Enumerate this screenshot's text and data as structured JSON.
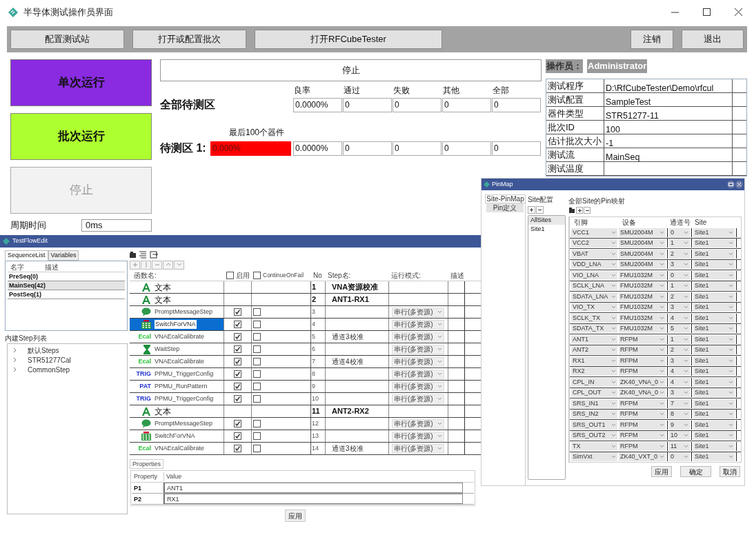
{
  "window": {
    "title": "半导体测试操作员界面"
  },
  "toolbar_left": [
    {
      "label": "配置测试站"
    },
    {
      "label": "打开或配置批次"
    },
    {
      "label": "打开RFCubeTester"
    }
  ],
  "toolbar_right": [
    {
      "label": "注销"
    },
    {
      "label": "退出"
    }
  ],
  "run_buttons": [
    {
      "label": "单次运行",
      "kind": "single",
      "disabled": false
    },
    {
      "label": "批次运行",
      "kind": "batch",
      "disabled": false
    },
    {
      "label": "停止",
      "kind": "stop",
      "disabled": true
    }
  ],
  "cycle_time": {
    "label": "周期时间",
    "value": "0ms"
  },
  "status": "停止",
  "stats": {
    "columns": [
      "良率",
      "通过",
      "失败",
      "其他",
      "全部"
    ],
    "all": {
      "label": "全部待测区",
      "values": [
        "0.0000%",
        "0",
        "0",
        "0",
        "0"
      ]
    },
    "sites": [
      {
        "label": "待测区 1:",
        "caption": "最后100个器件",
        "bar": "0.000%",
        "values": [
          "0.0000%",
          "0",
          "0",
          "0",
          "0"
        ]
      }
    ]
  },
  "operator": {
    "label": "操作员：",
    "name": "Administrator"
  },
  "info": [
    {
      "key": "测试程序",
      "value": "D:\\RfCubeTester\\Demo\\rfcul"
    },
    {
      "key": "测试配置",
      "value": "SampleTest"
    },
    {
      "key": "器件类型",
      "value": "STR51277-11"
    },
    {
      "key": "批次ID",
      "value": "100"
    },
    {
      "key": "估计批次大小",
      "value": "-1"
    },
    {
      "key": "测试流",
      "value": "MainSeq"
    },
    {
      "key": "测试温度"
    }
  ],
  "flow_editor": {
    "title": "TestFlowEdit",
    "tabs": [
      {
        "label": "SequenceList",
        "selected": true
      },
      {
        "label": "Variables",
        "selected": false
      }
    ],
    "sequence_columns": [
      "名字",
      "描述"
    ],
    "sequences": [
      {
        "name": "PreSeq(0)",
        "selected": false
      },
      {
        "name": "MainSeq(42)",
        "selected": true
      },
      {
        "name": "PostSeq(1)",
        "selected": false
      }
    ],
    "builtin_title": "内建Step列表",
    "builtin": [
      {
        "label": "默认Steps",
        "expanded": false
      },
      {
        "label": "STR51277Cal",
        "expanded": false
      },
      {
        "label": "CommonStep",
        "expanded": false
      }
    ],
    "columns": {
      "func": "函数名:",
      "enabled": "启用",
      "continue": "ContinueOnFail",
      "no": "No",
      "step": "Step名:",
      "mode": "运行模式:",
      "desc": "描述"
    },
    "header_checks": {
      "enabled": false,
      "continue": false
    },
    "steps": [
      {
        "kind": "text",
        "name": "文本",
        "no": "1",
        "step": "VNA资源校准",
        "selected": false
      },
      {
        "kind": "text",
        "name": "文本",
        "no": "2",
        "step": "ANT1-RX1",
        "selected": false
      },
      {
        "kind": "prompt",
        "name": "PromptMessageStep",
        "enabled": true,
        "continue_on_fail": false,
        "no": "3",
        "mode": "串行(多资源)",
        "selected": false
      },
      {
        "kind": "switch",
        "name": "SwitchForVNA",
        "enabled": true,
        "continue_on_fail": false,
        "no": "4",
        "mode": "串行(多资源)",
        "selected": true
      },
      {
        "kind": "tag",
        "tag": "Ecal",
        "name": "VNAEcalCalibrate",
        "enabled": true,
        "continue_on_fail": false,
        "no": "5",
        "step": "通道3校准",
        "mode": "串行(多资源)",
        "selected": false
      },
      {
        "kind": "wait",
        "name": "WaitStep",
        "enabled": true,
        "continue_on_fail": false,
        "no": "6",
        "mode": "串行(多资源)",
        "selected": false
      },
      {
        "kind": "tag",
        "tag": "Ecal",
        "name": "VNAEcalCalibrate",
        "enabled": true,
        "continue_on_fail": false,
        "no": "7",
        "step": "通道4校准",
        "mode": "串行(多资源)",
        "selected": false
      },
      {
        "kind": "tag",
        "tag": "TRIG",
        "name": "PPMU_TriggerConfig",
        "enabled": true,
        "continue_on_fail": false,
        "no": "8",
        "mode": "串行(多资源)",
        "selected": false
      },
      {
        "kind": "tag",
        "tag": "PAT",
        "name": "PPMU_RunPattern",
        "enabled": true,
        "continue_on_fail": false,
        "no": "9",
        "mode": "串行(多资源)",
        "selected": false
      },
      {
        "kind": "tag",
        "tag": "TRIG",
        "name": "PPMU_TriggerConfig",
        "enabled": true,
        "continue_on_fail": false,
        "no": "10",
        "mode": "串行(多资源)",
        "selected": false
      },
      {
        "kind": "text",
        "name": "文本",
        "no": "11",
        "step": "ANT2-RX2",
        "selected": false
      },
      {
        "kind": "prompt",
        "name": "PromptMessageStep",
        "enabled": true,
        "continue_on_fail": false,
        "no": "12",
        "mode": "串行(多资源)",
        "selected": false
      },
      {
        "kind": "switch",
        "name": "SwitchForVNA",
        "enabled": true,
        "continue_on_fail": false,
        "no": "13",
        "mode": "串行(多资源)",
        "selected": false
      },
      {
        "kind": "tag",
        "tag": "Ecal",
        "name": "VNAEcalCalibrate",
        "enabled": true,
        "continue_on_fail": false,
        "no": "14",
        "step": "通道3校准",
        "mode": "串行(多资源)",
        "selected": false
      }
    ],
    "properties_tab": "Properties",
    "property_columns": [
      "Property",
      "Value"
    ],
    "properties": [
      {
        "name": "P1",
        "value": "ANT1"
      },
      {
        "name": "P2",
        "value": "RX1"
      }
    ],
    "apply": "应用"
  },
  "pinmap": {
    "title": "PinMap",
    "tabs": [
      {
        "label": "Site-PinMap",
        "selected": true
      },
      {
        "label": "Pin定义",
        "selected": false
      }
    ],
    "site_group": "Site配置",
    "sites": [
      {
        "label": "AllSites",
        "selected": true
      },
      {
        "label": "Site1",
        "selected": false
      }
    ],
    "heading": "全部Site的Pin映射",
    "columns": [
      "引脚",
      "设备",
      "通道号",
      "Site"
    ],
    "rows": [
      {
        "pin": "VCC1",
        "device": "SMU2004M",
        "channel": "0",
        "site": "Site1"
      },
      {
        "pin": "VCC2",
        "device": "SMU2004M",
        "channel": "1",
        "site": "Site1"
      },
      {
        "pin": "VBAT",
        "device": "SMU2004M",
        "channel": "2",
        "site": "Site1"
      },
      {
        "pin": "VDD_LNA",
        "device": "SMU2004M",
        "channel": "3",
        "site": "Site1"
      },
      {
        "pin": "VIO_LNA",
        "device": "FMU1032M",
        "channel": "0",
        "site": "Site1"
      },
      {
        "pin": "SCLK_LNA",
        "device": "FMU1032M",
        "channel": "1",
        "site": "Site1"
      },
      {
        "pin": "SDATA_LNA",
        "device": "FMU1032M",
        "channel": "2",
        "site": "Site1"
      },
      {
        "pin": "VIO_TX",
        "device": "FMU1032M",
        "channel": "3",
        "site": "Site1"
      },
      {
        "pin": "SCLK_TX",
        "device": "FMU1032M",
        "channel": "4",
        "site": "Site1"
      },
      {
        "pin": "SDATA_TX",
        "device": "FMU1032M",
        "channel": "5",
        "site": "Site1"
      },
      {
        "pin": "ANT1",
        "device": "RFPM",
        "channel": "1",
        "site": "Site1"
      },
      {
        "pin": "ANT2",
        "device": "RFPM",
        "channel": "2",
        "site": "Site1"
      },
      {
        "pin": "RX1",
        "device": "RFPM",
        "channel": "3",
        "site": "Site1"
      },
      {
        "pin": "RX2",
        "device": "RFPM",
        "channel": "4",
        "site": "Site1"
      },
      {
        "pin": "CPL_IN",
        "device": "ZK40_VNA_0",
        "channel": "4",
        "site": "Site1"
      },
      {
        "pin": "CPL_OUT",
        "device": "ZK40_VNA_0",
        "channel": "3",
        "site": "Site1"
      },
      {
        "pin": "SRS_IN1",
        "device": "RFPM",
        "channel": "7",
        "site": "Site1"
      },
      {
        "pin": "SRS_IN2",
        "device": "RFPM",
        "channel": "8",
        "site": "Site1"
      },
      {
        "pin": "SRS_OUT1",
        "device": "RFPM",
        "channel": "9",
        "site": "Site1"
      },
      {
        "pin": "SRS_OUT2",
        "device": "RFPM",
        "channel": "10",
        "site": "Site1"
      },
      {
        "pin": "TX",
        "device": "RFPM",
        "channel": "11",
        "site": "Site1"
      },
      {
        "pin": "SimVxt",
        "device": "ZK40_VXT_0",
        "channel": "0",
        "site": "Site1"
      }
    ],
    "buttons": [
      "应用",
      "确定",
      "取消"
    ]
  }
}
